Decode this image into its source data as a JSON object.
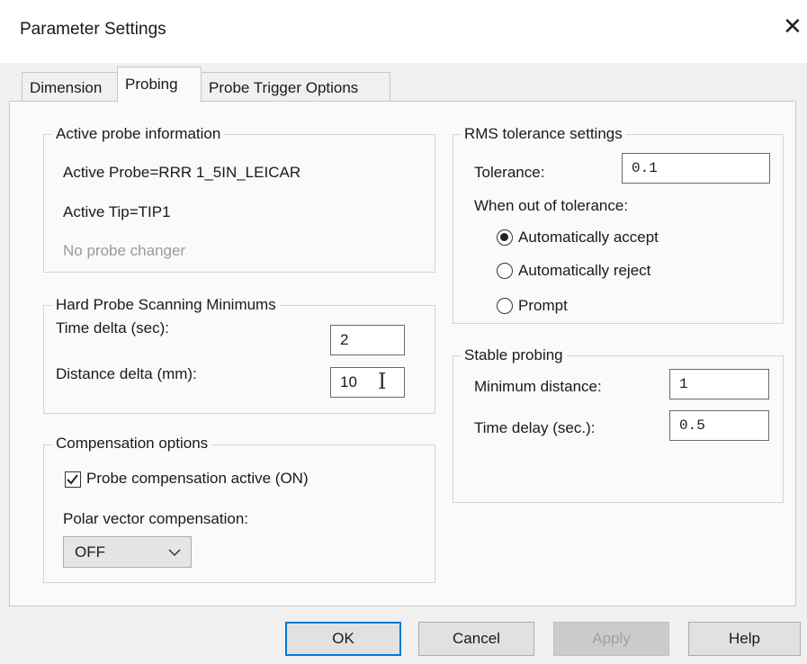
{
  "window": {
    "title": "Parameter Settings",
    "close_glyph": "✕"
  },
  "tabs": [
    {
      "label": "Dimension",
      "active": false
    },
    {
      "label": "Probing",
      "active": true
    },
    {
      "label": "Probe Trigger Options",
      "active": false
    }
  ],
  "active_probe": {
    "legend": "Active probe information",
    "probe": "Active Probe=RRR 1_5IN_LEICAR",
    "tip": "Active Tip=TIP1",
    "changer": "No probe changer"
  },
  "hard_probe": {
    "legend": "Hard Probe Scanning Minimums",
    "time_delta_label": "Time delta (sec):",
    "time_delta_value": "2",
    "distance_delta_label": "Distance delta (mm):",
    "distance_delta_value": "10"
  },
  "compensation": {
    "legend": "Compensation options",
    "probe_comp_label": "Probe compensation active (ON)",
    "probe_comp_checked": true,
    "polar_label": "Polar vector compensation:",
    "polar_value": "OFF"
  },
  "rms": {
    "legend": "RMS tolerance settings",
    "tolerance_label": "Tolerance:",
    "tolerance_value": "0.1",
    "out_of_tol_label": "When out of tolerance:",
    "options": [
      {
        "label": "Automatically accept",
        "selected": true
      },
      {
        "label": "Automatically reject",
        "selected": false
      },
      {
        "label": "Prompt",
        "selected": false
      }
    ]
  },
  "stable": {
    "legend": "Stable probing",
    "min_distance_label": "Minimum distance:",
    "min_distance_value": "1",
    "time_delay_label": "Time delay (sec.):",
    "time_delay_value": "0.5"
  },
  "buttons": {
    "ok": "OK",
    "cancel": "Cancel",
    "apply": "Apply",
    "help": "Help"
  },
  "colors": {
    "accent": "#0078d7",
    "dialog_bg": "#f0f0f0",
    "panel_bg": "#fafafa",
    "disabled_text": "#a0a0a0"
  }
}
